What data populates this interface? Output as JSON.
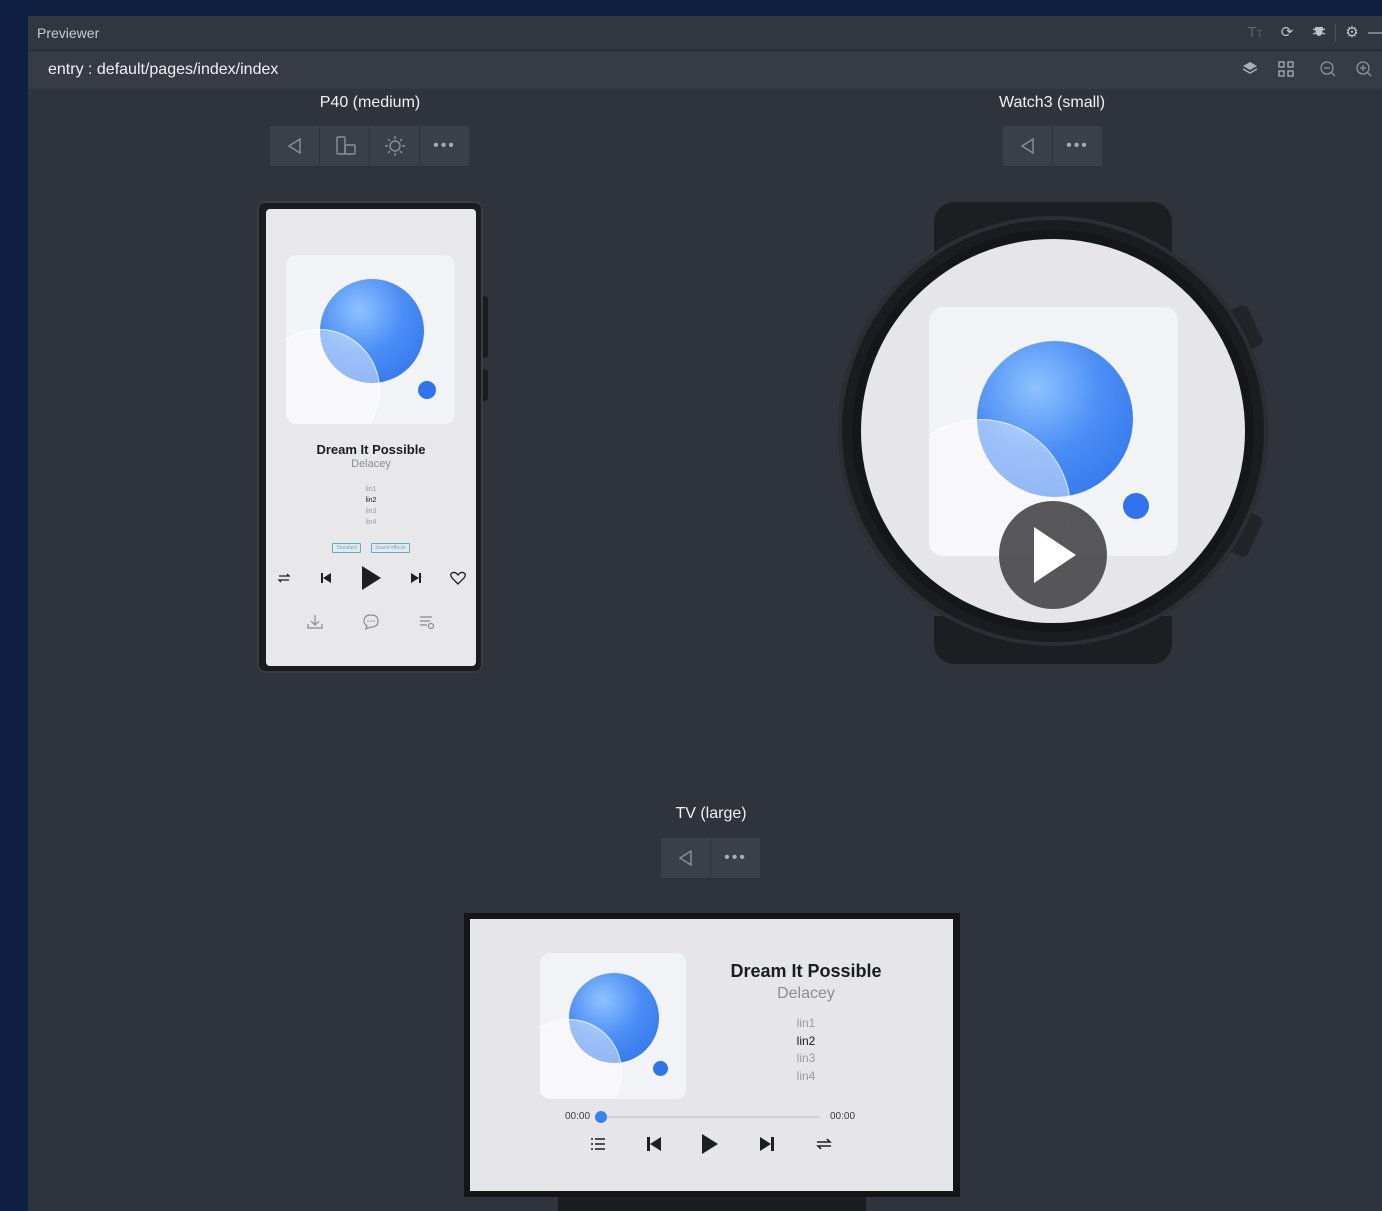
{
  "window": {
    "title": "Previewer",
    "title_icons": [
      "font-size-icon",
      "refresh-icon",
      "bug-icon",
      "settings-icon",
      "minimize-icon"
    ],
    "path": "entry : default/pages/index/index",
    "path_icons": [
      "layers-icon",
      "multi-device-icon",
      "zoom-out-icon",
      "zoom-in-icon"
    ]
  },
  "devices": {
    "phone": {
      "title": "P40 (medium)"
    },
    "watch": {
      "title": "Watch3 (small)"
    },
    "tv": {
      "title": "TV (large)"
    }
  },
  "song": {
    "title": "Dream It Possible",
    "artist": "Delacey",
    "lyrics": [
      "lin1",
      "lin2",
      "lin3",
      "lin4"
    ],
    "active_lyric_index": 1
  },
  "phone_tags": [
    "Standard",
    "Sound effects"
  ],
  "tv_player": {
    "current_time": "00:00",
    "total_time": "00:00",
    "progress": 0
  },
  "colors": {
    "accent": "#3a80f0",
    "background": "#2f333c",
    "tag": "#5ab3c8"
  }
}
